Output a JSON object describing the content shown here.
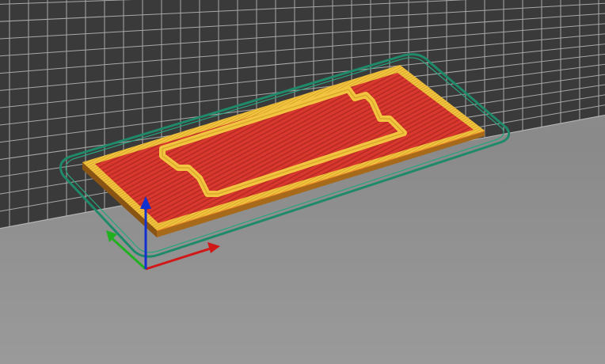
{
  "viewport": {
    "background_color": "#8c8c8c",
    "bed_color": "#3a3a3a",
    "grid_color": "#bcbcbc"
  },
  "toolpath": {
    "skirt_color": "#1f8a6a",
    "perimeter_color": "#f2c440",
    "infill_color": "#d8382e",
    "edge_color": "#f08a2a",
    "shadow_color": "#a66a1a"
  },
  "axes": {
    "x_color": "#d01818",
    "y_color": "#20b020",
    "z_color": "#1030d0"
  }
}
